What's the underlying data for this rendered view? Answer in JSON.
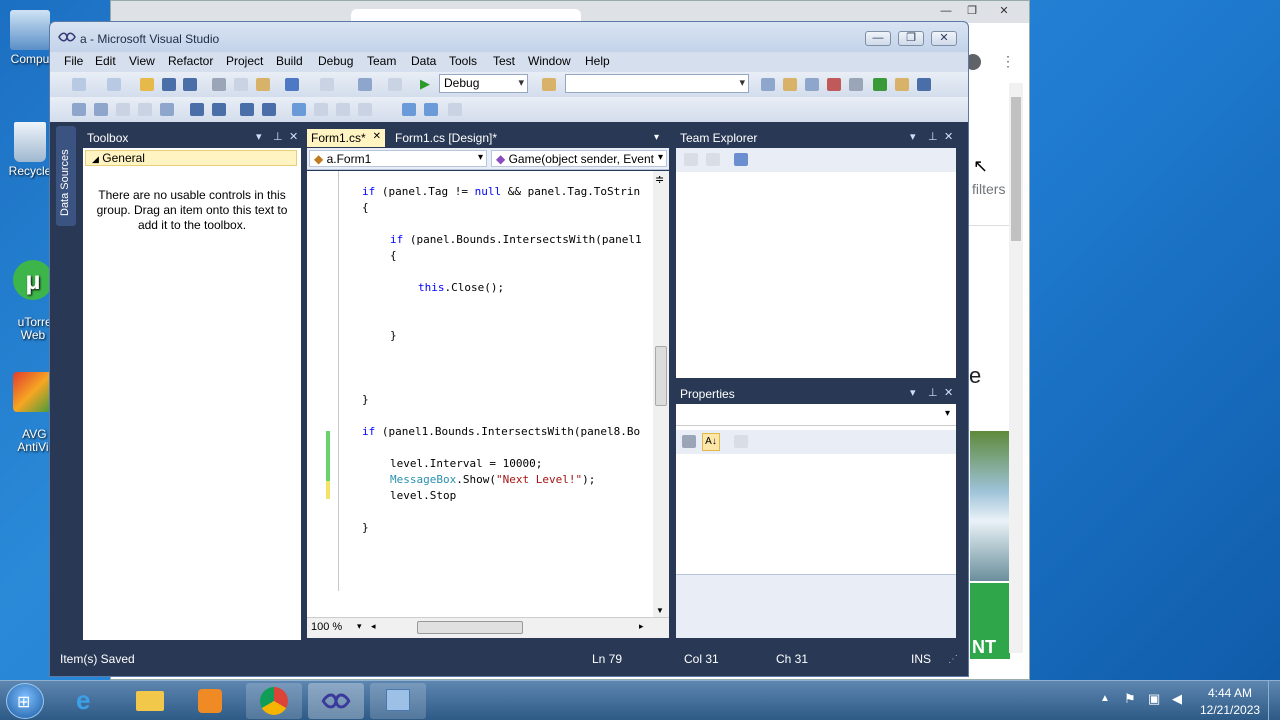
{
  "desktop": {
    "icons": [
      {
        "label": "Compu"
      },
      {
        "label": "Recycle"
      },
      {
        "label": "uTorre\nWeb"
      },
      {
        "label": "AVG\nAntiVi"
      }
    ]
  },
  "chrome": {
    "filters": "filters",
    "partial_letter": "e",
    "partial_banner": "NT"
  },
  "vs": {
    "title": "a - Microsoft Visual Studio",
    "menu": [
      "File",
      "Edit",
      "View",
      "Refactor",
      "Project",
      "Build",
      "Debug",
      "Team",
      "Data",
      "Tools",
      "Test",
      "Window",
      "Help"
    ],
    "config": "Debug",
    "toolbox": {
      "title": "Toolbox",
      "group": "General",
      "empty_text": "There are no usable controls in this group. Drag an item onto this text to add it to the toolbox.",
      "side_tab": "Data Sources"
    },
    "tabs": [
      {
        "label": "Form1.cs*"
      },
      {
        "label": "Form1.cs [Design]*"
      }
    ],
    "nav": {
      "class": "a.Form1",
      "member": "Game(object sender, Event"
    },
    "code": [
      {
        "y": 0,
        "segs": [
          [
            "kw",
            "if"
          ],
          [
            "",
            "(panel.Tag != "
          ],
          [
            "kw",
            "null"
          ],
          [
            "",
            "&& panel.Tag.ToStrin"
          ]
        ]
      },
      {
        "y": 1,
        "segs": [
          [
            "",
            "{"
          ]
        ]
      },
      {
        "y": 3,
        "ind": 2,
        "segs": [
          [
            "kw",
            "if"
          ],
          [
            "",
            "(panel.Bounds.IntersectsWith(panel1"
          ]
        ]
      },
      {
        "y": 4,
        "ind": 2,
        "segs": [
          [
            "",
            "{"
          ]
        ]
      },
      {
        "y": 6,
        "ind": 4,
        "segs": [
          [
            "kw",
            "this"
          ],
          [
            "",
            ".Close();"
          ]
        ]
      },
      {
        "y": 9,
        "ind": 2,
        "segs": [
          [
            "",
            "}"
          ]
        ]
      },
      {
        "y": 13,
        "segs": [
          [
            "",
            "}"
          ]
        ]
      },
      {
        "y": 15,
        "segs": [
          [
            "kw",
            "if"
          ],
          [
            "",
            "(panel1.Bounds.IntersectsWith(panel8.Bo"
          ]
        ]
      },
      {
        "y": 17,
        "ind": 2,
        "segs": [
          [
            "",
            "level.Interval = 10000;"
          ]
        ]
      },
      {
        "y": 18,
        "ind": 2,
        "segs": [
          [
            "ty",
            "MessageBox"
          ],
          [
            "",
            ".Show("
          ],
          [
            "st",
            "\"Next Level!\""
          ],
          [
            "",
            ");"
          ]
        ]
      },
      {
        "y": 19,
        "ind": 2,
        "segs": [
          [
            "",
            "level.Stop"
          ]
        ]
      },
      {
        "y": 21,
        "segs": [
          [
            "",
            "}"
          ]
        ]
      }
    ],
    "zoom": "100 %",
    "team_explorer": {
      "title": "Team Explorer"
    },
    "properties": {
      "title": "Properties"
    },
    "status": {
      "message": "Item(s) Saved",
      "ln": "Ln 79",
      "col": "Col 31",
      "ch": "Ch 31",
      "mode": "INS"
    }
  },
  "taskbar": {
    "time": "4:44 AM",
    "date": "12/21/2023"
  }
}
